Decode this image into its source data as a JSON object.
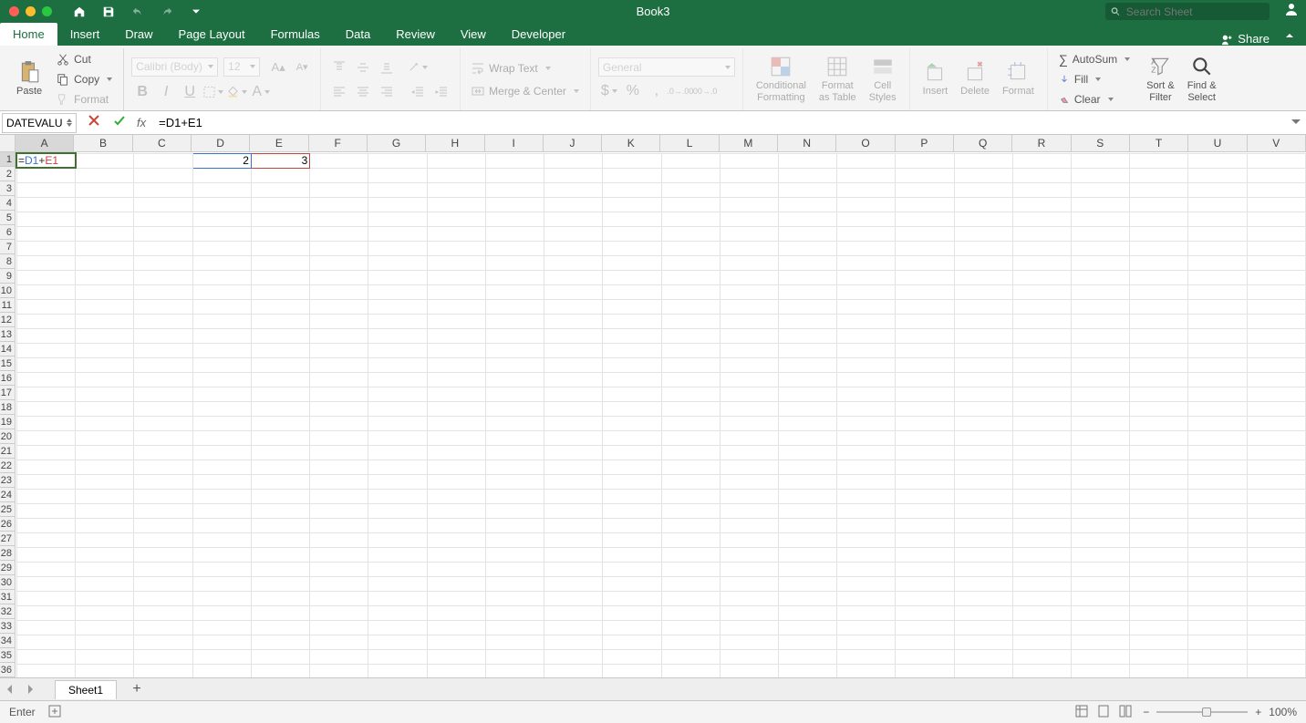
{
  "title": "Book3",
  "search_placeholder": "Search Sheet",
  "tabs": [
    "Home",
    "Insert",
    "Draw",
    "Page Layout",
    "Formulas",
    "Data",
    "Review",
    "View",
    "Developer"
  ],
  "active_tab": "Home",
  "share_label": "Share",
  "clipboard": {
    "paste": "Paste",
    "cut": "Cut",
    "copy": "Copy",
    "format": "Format"
  },
  "font": {
    "name": "Calibri (Body)",
    "size": "12"
  },
  "alignment": {
    "wrap": "Wrap Text",
    "merge": "Merge & Center"
  },
  "number_format": "General",
  "styles": {
    "cond": "Conditional\nFormatting",
    "table": "Format\nas Table",
    "cell": "Cell\nStyles"
  },
  "cells_grp": {
    "insert": "Insert",
    "delete": "Delete",
    "format": "Format"
  },
  "editing": {
    "autosum": "AutoSum",
    "fill": "Fill",
    "clear": "Clear",
    "sort": "Sort &\nFilter",
    "find": "Find &\nSelect"
  },
  "namebox": "DATEVALU",
  "formula": "=D1+E1",
  "formula_parts": {
    "eq": "=",
    "r1": "D1",
    "op": "+",
    "r2": "E1"
  },
  "columns": [
    "A",
    "B",
    "C",
    "D",
    "E",
    "F",
    "G",
    "H",
    "I",
    "J",
    "K",
    "L",
    "M",
    "N",
    "O",
    "P",
    "Q",
    "R",
    "S",
    "T",
    "U",
    "V"
  ],
  "rows": 36,
  "d1_value": "2",
  "e1_value": "3",
  "sheet_tab": "Sheet1",
  "status_mode": "Enter",
  "zoom": "100%"
}
